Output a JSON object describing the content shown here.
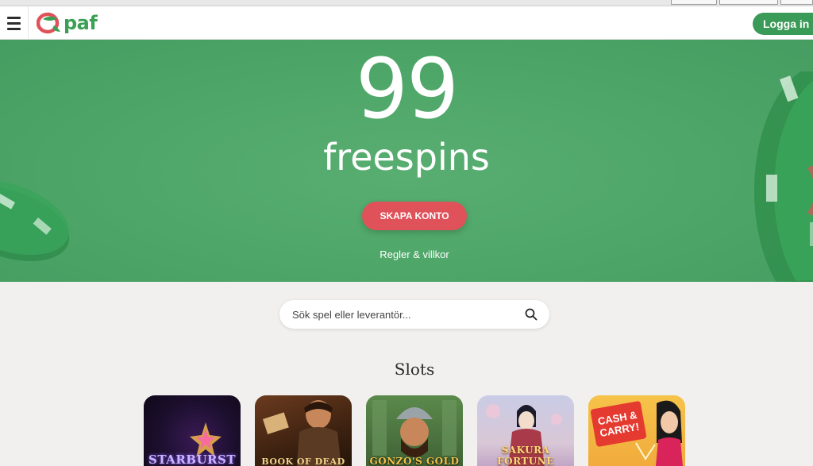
{
  "header": {
    "logo_text": "paf",
    "login_label": "Logga in"
  },
  "hero": {
    "number": "99",
    "subtitle": "freespins",
    "cta_label": "SKAPA KONTO",
    "terms_label": "Regler & villkor"
  },
  "search": {
    "placeholder": "Sök spel eller leverantör..."
  },
  "section": {
    "title": "Slots"
  },
  "games": [
    {
      "title": "STARBURST"
    },
    {
      "title": "BOOK OF DEAD"
    },
    {
      "title": "GONZO'S GOLD"
    },
    {
      "title": "SAKURA FORTUNE"
    },
    {
      "title": "CASH & CARRY!"
    }
  ],
  "colors": {
    "brand_green": "#3a9a57",
    "hero_green": "#4fa769",
    "cta_red": "#e0525a",
    "background": "#f1f0ee"
  },
  "icons": [
    "hamburger-menu-icon",
    "paf-logo-icon",
    "search-icon"
  ]
}
